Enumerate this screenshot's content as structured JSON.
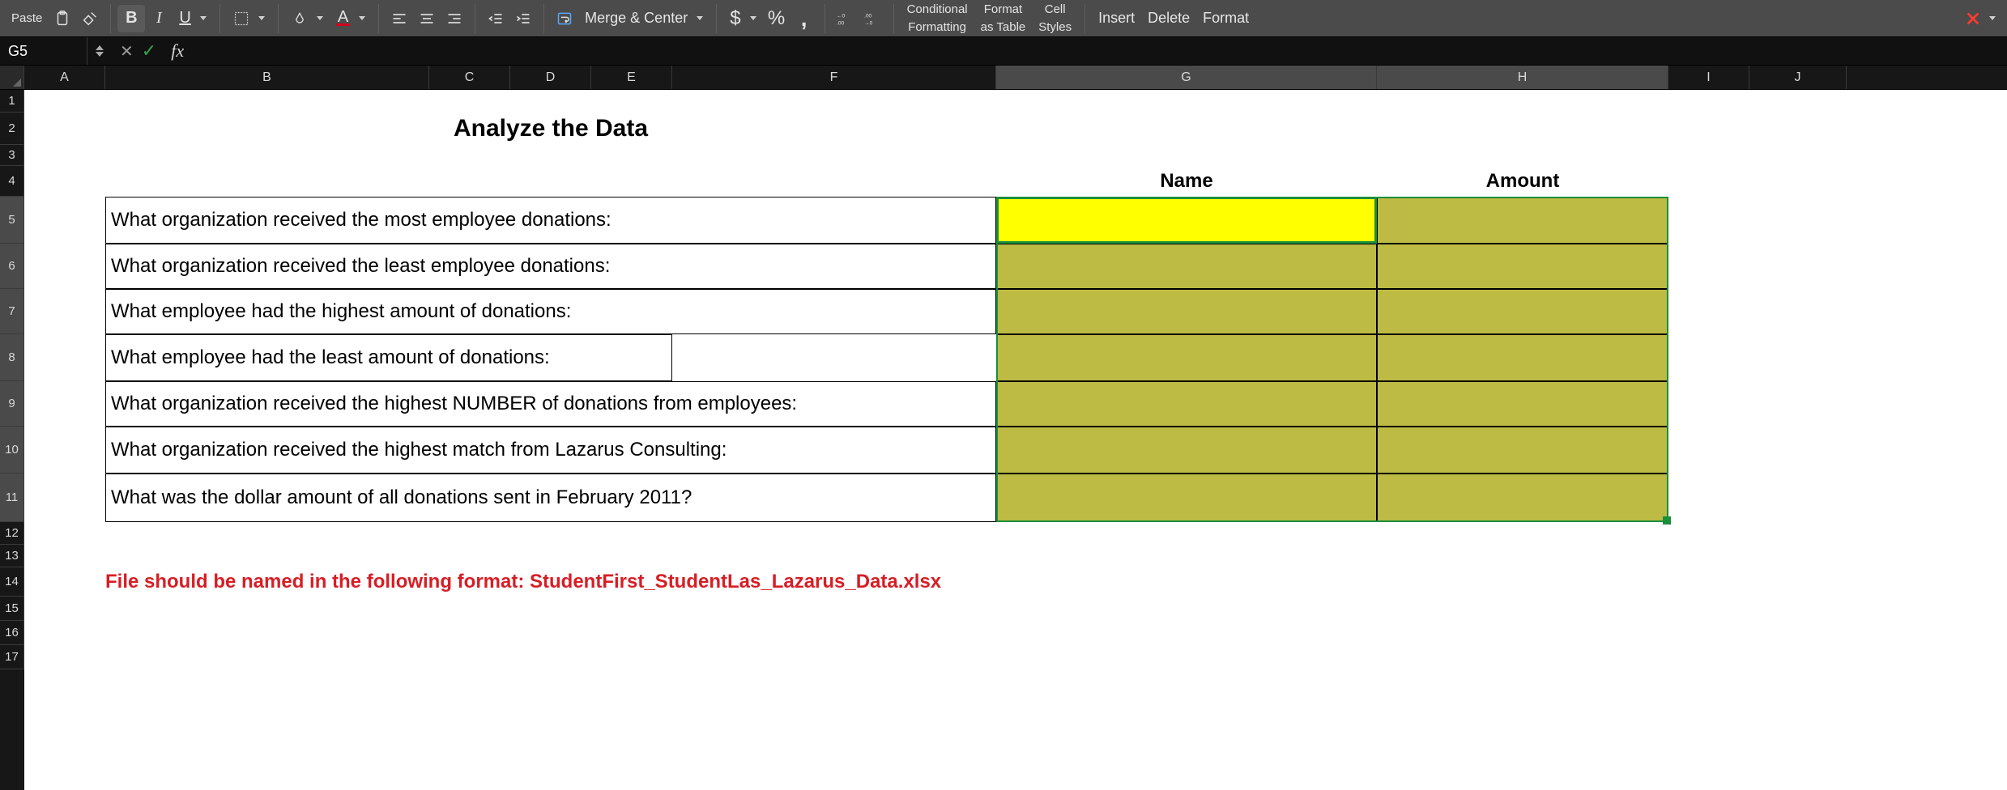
{
  "ribbon": {
    "paste_label": "Paste",
    "merge_center_label": "Merge & Center",
    "conditional_formatting_l1": "Conditional",
    "conditional_formatting_l2": "Formatting",
    "format_as_table_l1": "Format",
    "format_as_table_l2": "as Table",
    "cell_styles_l1": "Cell",
    "cell_styles_l2": "Styles",
    "insert_label": "Insert",
    "delete_label": "Delete",
    "format_label": "Format",
    "currency_symbol": "$",
    "percent_symbol": "%",
    "comma_symbol": ",",
    "bold_symbol": "B",
    "italic_symbol": "I",
    "underline_symbol": "U"
  },
  "formula_bar": {
    "name_box": "G5",
    "fx_label": "fx",
    "formula_value": ""
  },
  "columns": [
    "A",
    "B",
    "C",
    "D",
    "E",
    "F",
    "G",
    "H",
    "I",
    "J"
  ],
  "rows": [
    "1",
    "2",
    "3",
    "4",
    "5",
    "6",
    "7",
    "8",
    "9",
    "10",
    "11",
    "12",
    "13",
    "14",
    "15",
    "16",
    "17"
  ],
  "selected_column": "G",
  "selected_row": "5",
  "sheet": {
    "title": "Analyze the Data",
    "header_name": "Name",
    "header_amount": "Amount",
    "questions": {
      "q5": "What organization received the most employee donations:",
      "q6": "What organization received the least employee donations:",
      "q7": "What employee had the highest amount of donations:",
      "q8": "What employee had the least amount of donations:",
      "q9": "What organization received the highest NUMBER of donations from employees:",
      "q10": "What organization received the highest match from Lazarus Consulting:",
      "q11": "What was the dollar amount of all donations sent in February 2011?"
    },
    "footer_note": "File should be named in the following format:  StudentFirst_StudentLas_Lazarus_Data.xlsx"
  },
  "colors": {
    "ribbon_bg": "#4b4b4b",
    "answer_fill": "#bdbb44",
    "active_fill": "#ffff00",
    "selection_border": "#1b8f3a",
    "note_red": "#d71e25"
  }
}
